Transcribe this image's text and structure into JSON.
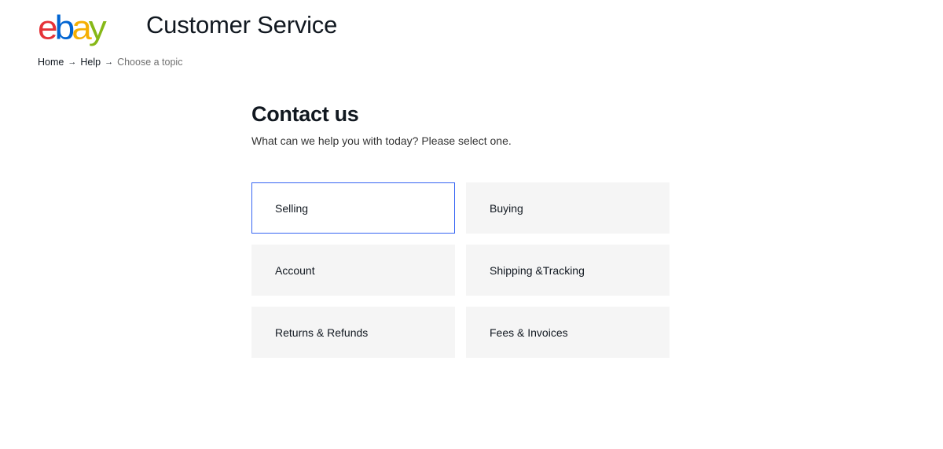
{
  "header": {
    "logo_letters": [
      "e",
      "b",
      "a",
      "y"
    ],
    "logo_colors": [
      "#e53238",
      "#0064d2",
      "#f5af02",
      "#86b817"
    ],
    "title": "Customer Service"
  },
  "breadcrumb": {
    "items": [
      "Home",
      "Help"
    ],
    "current": "Choose a topic",
    "separator": "→"
  },
  "main": {
    "heading": "Contact us",
    "subtitle": "What can we help you with today? Please select one."
  },
  "topics": [
    {
      "label": "Selling",
      "selected": true
    },
    {
      "label": "Buying",
      "selected": false
    },
    {
      "label": "Account",
      "selected": false
    },
    {
      "label": "Shipping &Tracking",
      "selected": false
    },
    {
      "label": "Returns & Refunds",
      "selected": false
    },
    {
      "label": "Fees & Invoices",
      "selected": false
    }
  ],
  "colors": {
    "selected_border": "#3665f3",
    "tile_background": "#f5f5f5",
    "text": "#111820"
  }
}
